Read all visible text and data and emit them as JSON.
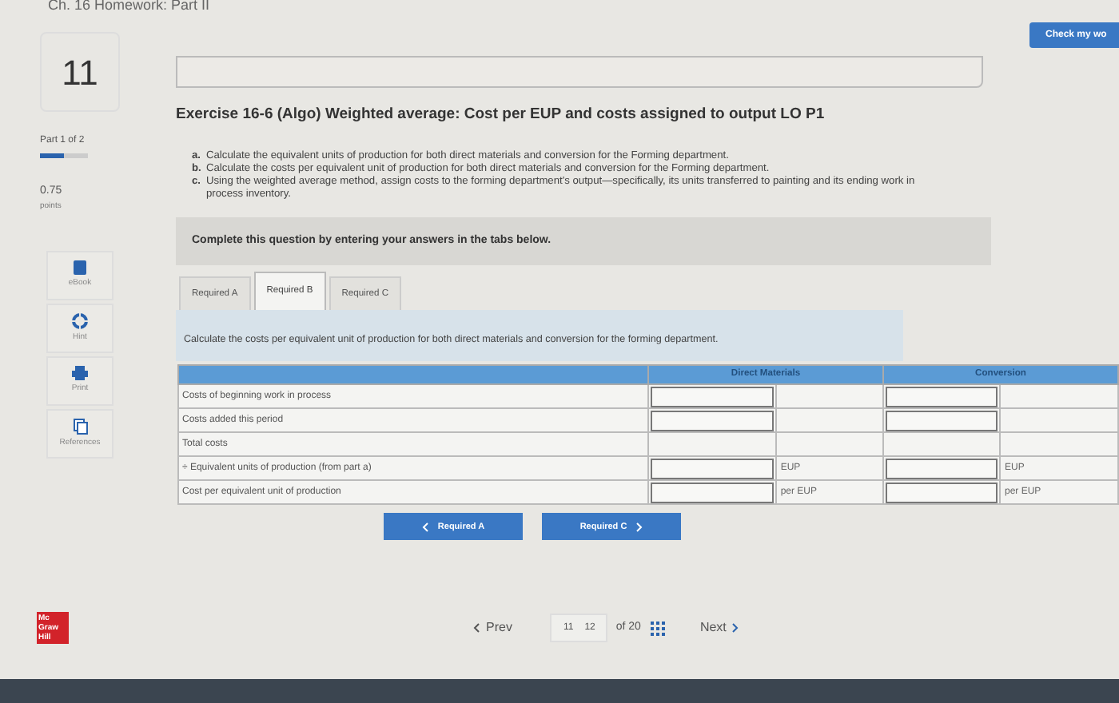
{
  "header": {
    "title": "Ch. 16 Homework: Part II",
    "check_button": "Check my wo"
  },
  "question": {
    "number": "11",
    "part": "Part 1 of 2",
    "part_progress": {
      "level": 0.5
    },
    "points": "0.75",
    "points_label": "points"
  },
  "tools": [
    {
      "kind": "book",
      "label": "eBook"
    },
    {
      "kind": "hint",
      "label": "Hint"
    },
    {
      "kind": "print",
      "label": "Print"
    },
    {
      "kind": "references",
      "label": "References"
    }
  ],
  "exercise": {
    "title": "Exercise 16-6 (Algo) Weighted average: Cost per EUP and costs assigned to output LO P1",
    "instructions": [
      {
        "letter": "a.",
        "text": "Calculate the equivalent units of production for both direct materials and conversion for the Forming department."
      },
      {
        "letter": "b.",
        "text": "Calculate the costs per equivalent unit of production for both direct materials and conversion for the Forming department."
      },
      {
        "letter": "c.",
        "text": "Using the weighted average method, assign costs to the forming department's output—specifically, its units transferred to painting and its ending work in process inventory."
      }
    ],
    "notice": "Complete this question by entering your answers in the tabs below."
  },
  "tabs": [
    {
      "label": "Required A",
      "selected": false
    },
    {
      "label": "Required B",
      "selected": true
    },
    {
      "label": "Required C",
      "selected": false
    }
  ],
  "tab_instruction": "Calculate the costs per equivalent unit of production for both direct materials and conversion for the forming department.",
  "table": {
    "columns": [
      "Direct Materials",
      "Conversion"
    ],
    "rows": [
      {
        "label": "Costs of beginning work in process",
        "kind": "input"
      },
      {
        "label": "Costs added this period",
        "kind": "input"
      },
      {
        "label": "Total costs",
        "kind": "total"
      },
      {
        "label": "÷ Equivalent units of production (from part a)",
        "kind": "input",
        "dm_unit": "EUP",
        "conv_unit": "EUP"
      },
      {
        "label": "Cost per equivalent unit of production",
        "kind": "input",
        "dm_unit": "per EUP",
        "conv_unit": "per EUP"
      }
    ]
  },
  "nav_buttons": {
    "previous": "Required A",
    "next": "Required C"
  },
  "pager": {
    "prev": "Prev",
    "current": "11",
    "next_page": "12",
    "total": "of 20",
    "next": "Next"
  },
  "logo": "Mc Graw Hill"
}
